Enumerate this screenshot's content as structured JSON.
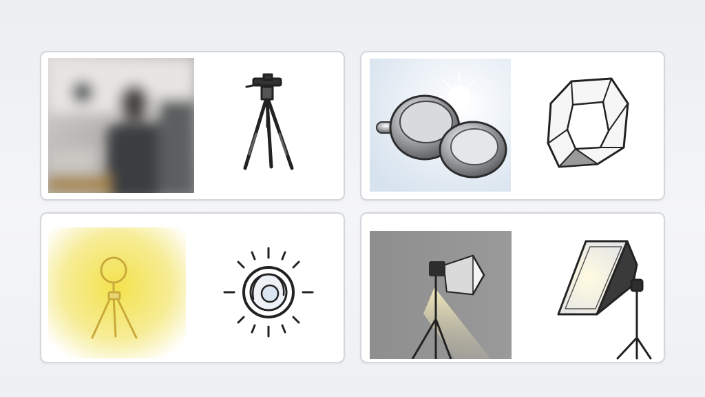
{
  "cards": [
    {
      "photo": "blurred-studio-person-photo",
      "icon": "tripod-icon"
    },
    {
      "photo": "metal-reflector-bowls-photo",
      "icon": "softbox-diffuser-icon"
    },
    {
      "photo": "glowing-ring-light-photo",
      "icon": "lens-sun-icon"
    },
    {
      "photo": "softbox-on-stand-photo",
      "icon": "rectangular-softbox-icon"
    }
  ],
  "colors": {
    "background": "#eef0f3",
    "card": "#ffffff",
    "card_border": "#d3d6db",
    "glow": "#f2e04a"
  }
}
